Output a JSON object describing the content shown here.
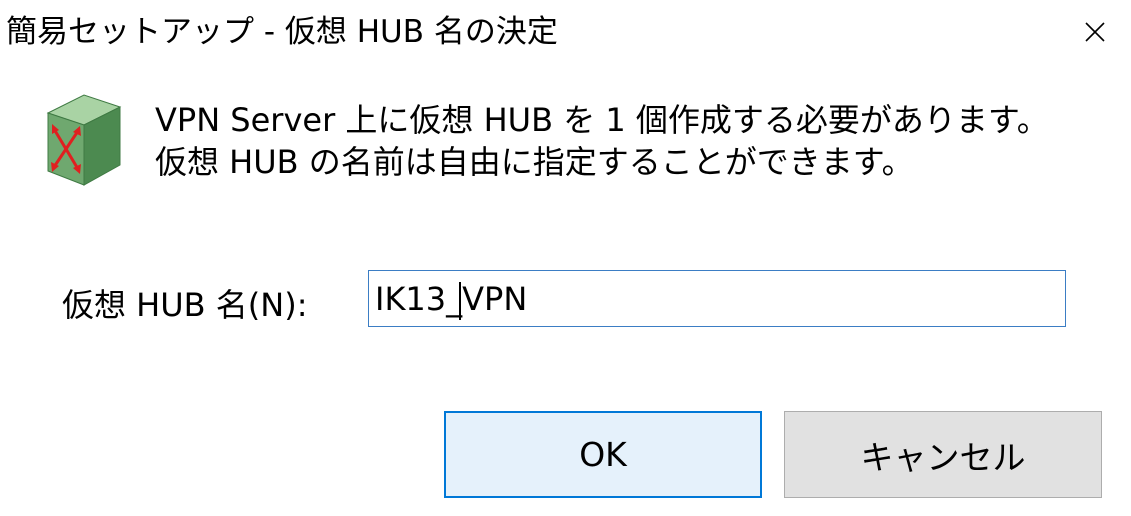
{
  "window": {
    "title": "簡易セットアップ - 仮想 HUB 名の決定",
    "close_symbol": "✕"
  },
  "icon": {
    "name": "virtual-hub-icon",
    "colors": {
      "face": "#6fa86f",
      "top": "#a9d3a4",
      "side": "#4c8a50",
      "arrows": "#e02020"
    }
  },
  "message": {
    "line1": "VPN Server 上に仮想 HUB を 1 個作成する必要があります。",
    "line2": "仮想 HUB の名前は自由に指定することができます。"
  },
  "hub_name": {
    "label": "仮想 HUB 名(N):",
    "value": "IK13_VPN"
  },
  "buttons": {
    "ok_label": "OK",
    "cancel_label": "キャンセル"
  },
  "colors": {
    "accent": "#0078d7",
    "input_border": "#3b7dc4",
    "ok_bg": "#e5f1fb",
    "cancel_bg": "#e1e1e1"
  }
}
